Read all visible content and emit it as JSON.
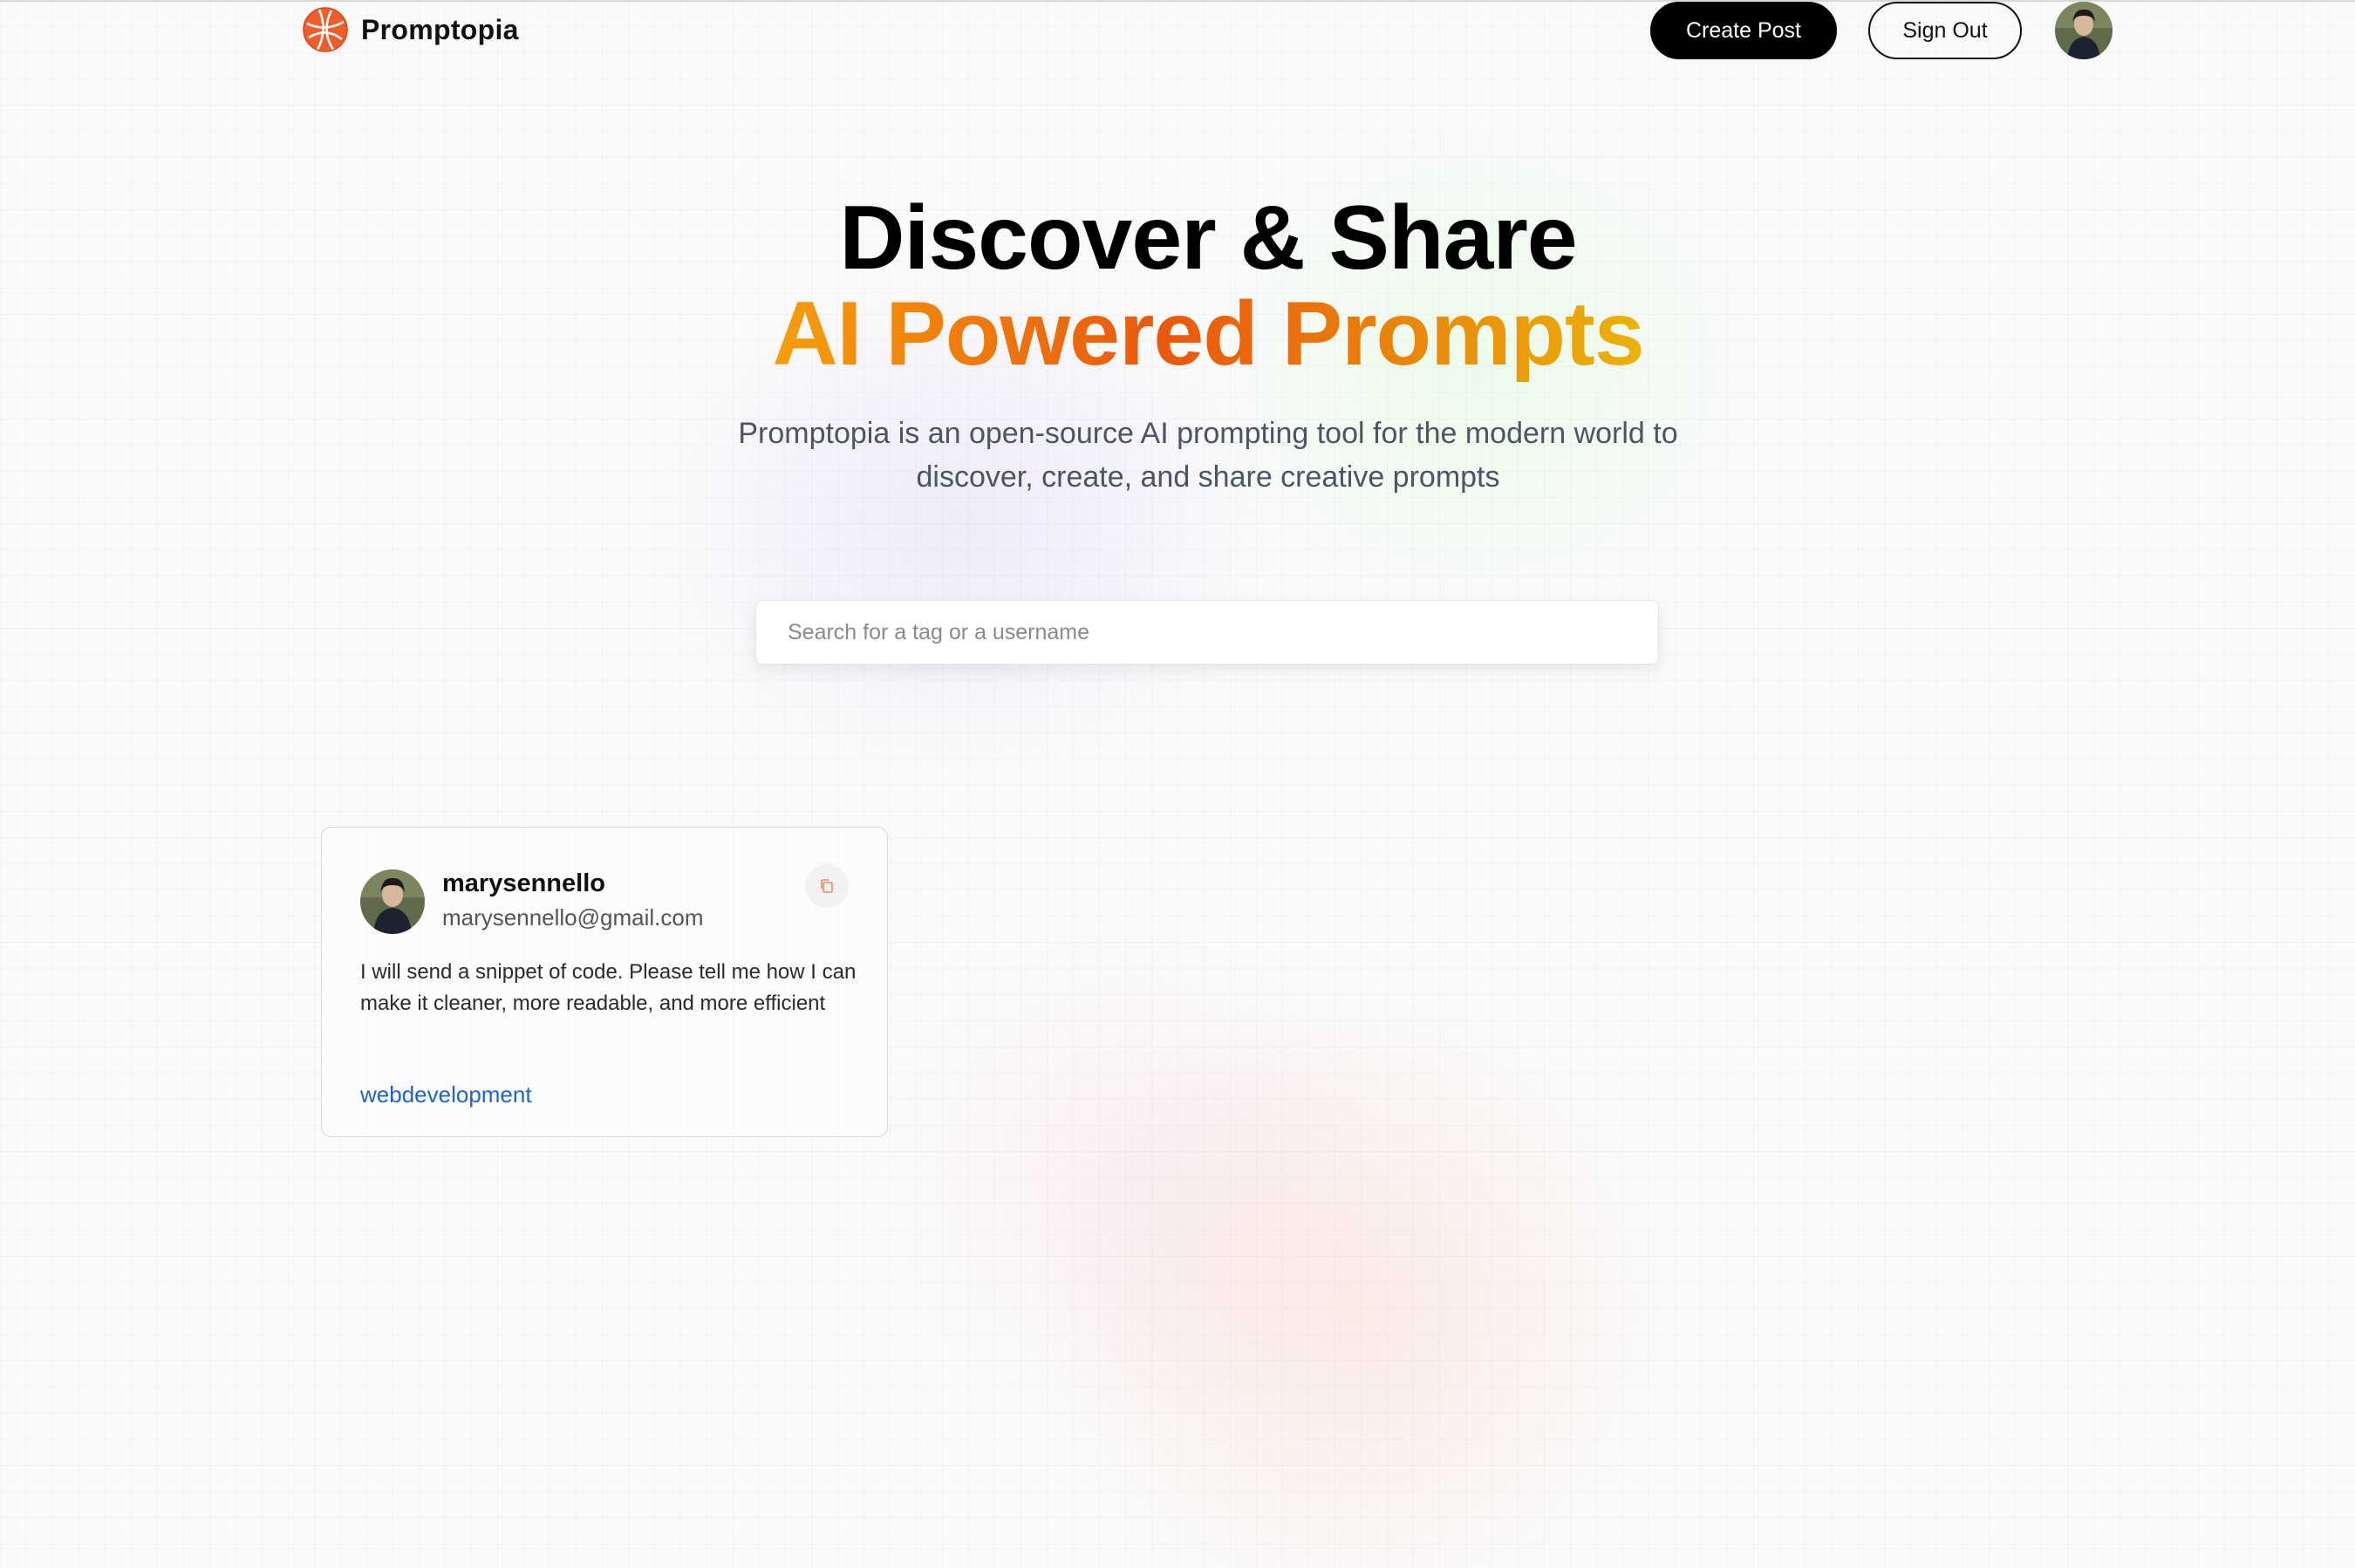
{
  "nav": {
    "brand_name": "Promptopia",
    "create_post_label": "Create Post",
    "sign_out_label": "Sign Out",
    "logo_icon": "globe-logo-icon",
    "avatar_icon": "user-avatar"
  },
  "hero": {
    "title_line1": "Discover & Share",
    "title_line2": "AI Powered Prompts",
    "description": "Promptopia is an open-source AI prompting tool for the modern world to discover, create, and share creative prompts"
  },
  "search": {
    "placeholder": "Search for a tag or a username",
    "value": ""
  },
  "feed": {
    "posts": [
      {
        "username": "marysennello",
        "email": "marysennello@gmail.com",
        "prompt": "I will send a snippet of code. Please tell me how I can make it cleaner, more readable, and more efficient",
        "tag": "webdevelopment",
        "copy_icon": "copy-icon"
      }
    ]
  },
  "colors": {
    "brand_orange": "#ea580c",
    "gradient_start": "#f59e0b",
    "gradient_end": "#eab308",
    "tag_blue": "#1d63d4"
  }
}
